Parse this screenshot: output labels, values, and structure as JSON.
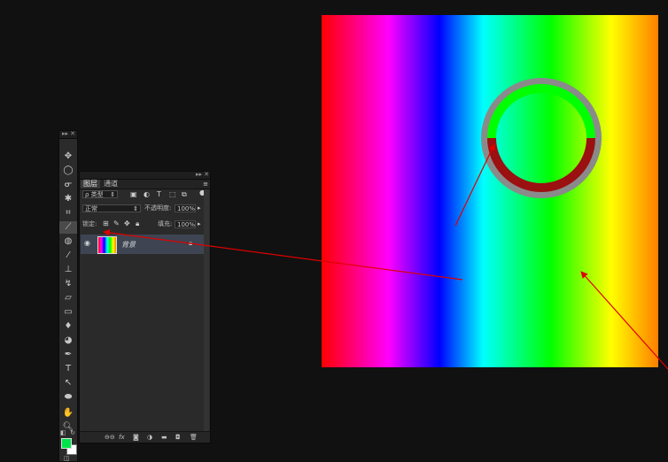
{
  "toolbar": {
    "tools": [
      {
        "name": "move-tool-icon",
        "glyph": "✥"
      },
      {
        "name": "elliptical-marquee-tool-icon",
        "glyph": "◯"
      },
      {
        "name": "lasso-tool-icon",
        "glyph": "ᓂ"
      },
      {
        "name": "magic-wand-tool-icon",
        "glyph": "✱"
      },
      {
        "name": "crop-tool-icon",
        "glyph": "⌗"
      },
      {
        "name": "eyedropper-tool-icon",
        "glyph": "⟋"
      },
      {
        "name": "spot-healing-tool-icon",
        "glyph": "◍"
      },
      {
        "name": "brush-tool-icon",
        "glyph": "⁄"
      },
      {
        "name": "clone-stamp-tool-icon",
        "glyph": "⊥"
      },
      {
        "name": "history-brush-tool-icon",
        "glyph": "↯"
      },
      {
        "name": "eraser-tool-icon",
        "glyph": "▱"
      },
      {
        "name": "gradient-tool-icon",
        "glyph": "▭"
      },
      {
        "name": "blur-tool-icon",
        "glyph": "♦"
      },
      {
        "name": "dodge-tool-icon",
        "glyph": "◕"
      },
      {
        "name": "pen-tool-icon",
        "glyph": "✒"
      },
      {
        "name": "type-tool-icon",
        "glyph": "T"
      },
      {
        "name": "path-selection-tool-icon",
        "glyph": "↖"
      },
      {
        "name": "ellipse-shape-tool-icon",
        "glyph": "⬬"
      },
      {
        "name": "hand-tool-icon",
        "glyph": "✋"
      },
      {
        "name": "zoom-tool-icon",
        "glyph": "🔍︎"
      }
    ],
    "foreground_color": "#00e64a",
    "background_color": "#ffffff"
  },
  "layers_panel": {
    "tabs": [
      "图层",
      "通道"
    ],
    "filter_label": "ρ 类型",
    "blend_mode": "正常",
    "opacity_label": "不透明度:",
    "opacity_value": "100%",
    "lock_label": "锁定:",
    "fill_label": "填充:",
    "fill_value": "100%",
    "layers": [
      {
        "name": "背景",
        "visible": true,
        "locked": true
      }
    ],
    "bottom_icons": [
      "link-icon",
      "fx-icon",
      "mask-icon",
      "adjustment-icon",
      "folder-icon",
      "new-layer-icon",
      "trash-icon"
    ]
  },
  "canvas": {
    "gradient_colors": [
      "#ff0000",
      "#ff00ff",
      "#0000ff",
      "#00ffff",
      "#00ff00",
      "#ffff00",
      "#ff7f00"
    ],
    "ring_colors": {
      "outer": "#8a8a8a",
      "upper": "#00ff00",
      "lower": "#9b1010"
    },
    "annotation_color": "#dd0000"
  }
}
